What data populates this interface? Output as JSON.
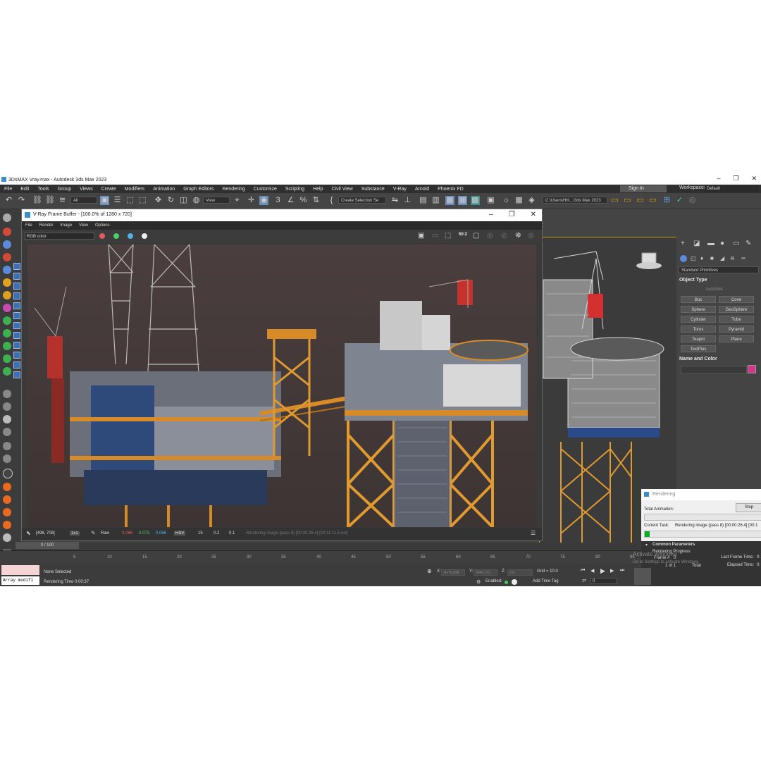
{
  "window": {
    "title": "3DsMAX Vray.max - Autodesk 3ds Max 2023",
    "min": "–",
    "max": "❐",
    "close": "✕"
  },
  "menu": [
    "File",
    "Edit",
    "Tools",
    "Group",
    "Views",
    "Create",
    "Modifiers",
    "Animation",
    "Graph Editors",
    "Rendering",
    "Customize",
    "Scripting",
    "Help",
    "Civil View",
    "Substance",
    "V-Ray",
    "Arnold",
    "Phoenix FD"
  ],
  "signin": "Sign In",
  "workspaces": {
    "label": "Workspaces:",
    "value": "Default"
  },
  "toolbar": {
    "filter": "All",
    "ref_coord": "View",
    "selection_set": "Create Selection Se",
    "path": "C:\\Users\\Hh\\...\\3ds Max 2023"
  },
  "vfb": {
    "title": "V-Ray Frame Buffer - [100.0% of 1280 x 720]",
    "menu": [
      "File",
      "Render",
      "Image",
      "View",
      "Options"
    ],
    "channel": "RGB color",
    "channel_colors": [
      "#e85a5a",
      "#4ccf6a",
      "#4fb2e8"
    ],
    "zoom_badge": "50:2",
    "status": {
      "coords": "[498, 708]",
      "ratio": "1x1",
      "raw": "Raw",
      "r": "0.086",
      "g": "0.073",
      "b": "0.068",
      "mode": "HSV",
      "h": "15",
      "s": "0.2",
      "v": "0.1",
      "message": "Rendering image (pass 8) [00:00:26.4] [00:11:11.5 est]"
    }
  },
  "command_panel": {
    "category": "Standard Primitives",
    "object_type_header": "Object Type",
    "autogrid": "AutoGrid",
    "buttons": [
      "Box",
      "Cone",
      "Sphere",
      "GeoSphere",
      "Cylinder",
      "Tube",
      "Torus",
      "Pyramid",
      "Teapot",
      "Plane",
      "TextPlus"
    ],
    "name_color_header": "Name and Color"
  },
  "timeline": {
    "frame": "0 / 100",
    "ticks": [
      "5",
      "10",
      "15",
      "20",
      "25",
      "30",
      "35",
      "40",
      "45",
      "50",
      "55",
      "60",
      "65",
      "70",
      "75",
      "80",
      "85",
      "90"
    ]
  },
  "status": {
    "selection": "None Selected",
    "render_time": "Rendering Time 0:00:37",
    "maxscript": "Array modifi",
    "x_label": "X:",
    "x_val": "-4176.898",
    "y_label": "Y:",
    "y_val": "3046.722",
    "z_label": "Z:",
    "z_val": "0.0",
    "grid": "Grid = 10.0",
    "enabled": "Enabled:",
    "add_time_tag": "Add Time Tag",
    "frame_field": "0"
  },
  "render_dialog": {
    "title": "Rendering",
    "stop": "Stop",
    "total_animation": "Total Animation:",
    "current_task_label": "Current Task:",
    "current_task": "Rendering image (pass 8) [00:00:26.4] [00:1",
    "progress_total": 0.0,
    "progress_task": 0.04,
    "common_params": "Common Parameters",
    "render_progress": "Rendering Progress:",
    "frame_label": "Frame #",
    "frame_val": "0",
    "of": "1 of 1",
    "total": "Total",
    "last_frame": "Last Frame Time:",
    "elapsed": "Elapsed Time:",
    "last_frame_val": "0:",
    "elapsed_val": "0:"
  },
  "watermark": {
    "line1": "Activate Windows",
    "line2": "Go to Settings to activate Windows."
  }
}
